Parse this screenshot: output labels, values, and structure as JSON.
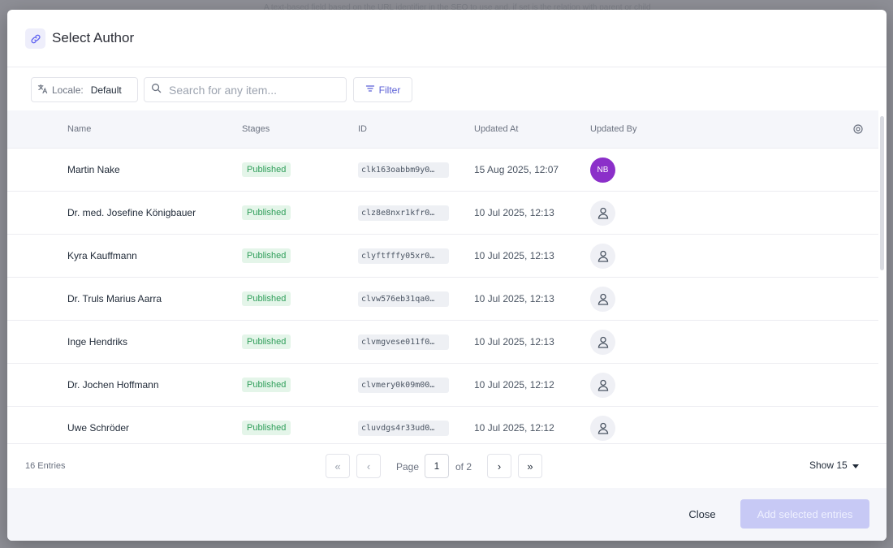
{
  "backdrop": {
    "text": "A text-based field based on the URL identifier in the SEO to use and, if set is the relation with parent or child"
  },
  "modal": {
    "title": "Select Author",
    "title_icon": "link-icon"
  },
  "toolbar": {
    "locale_label": "Locale:",
    "locale_value": "Default",
    "search_placeholder": "Search for any item...",
    "filter_label": "Filter"
  },
  "table": {
    "columns": {
      "name": "Name",
      "stages": "Stages",
      "id": "ID",
      "updated_at": "Updated At",
      "updated_by": "Updated By"
    },
    "rows": [
      {
        "name": "Martin Nake",
        "stage": "Published",
        "id": "clk163oabbm9y0…",
        "updated_at": "15 Aug 2025, 12:07",
        "updated_by": "NB",
        "avatar_type": "initials"
      },
      {
        "name": "Dr. med. Josefine Königbauer",
        "stage": "Published",
        "id": "clz8e8nxr1kfr0…",
        "updated_at": "10 Jul 2025, 12:13",
        "updated_by": "",
        "avatar_type": "generic"
      },
      {
        "name": "Kyra Kauffmann",
        "stage": "Published",
        "id": "clyftfffy05xr0…",
        "updated_at": "10 Jul 2025, 12:13",
        "updated_by": "",
        "avatar_type": "generic"
      },
      {
        "name": "Dr. Truls Marius Aarra",
        "stage": "Published",
        "id": "clvw576eb31qa0…",
        "updated_at": "10 Jul 2025, 12:13",
        "updated_by": "",
        "avatar_type": "generic"
      },
      {
        "name": "Inge Hendriks",
        "stage": "Published",
        "id": "clvmgvese011f0…",
        "updated_at": "10 Jul 2025, 12:13",
        "updated_by": "",
        "avatar_type": "generic"
      },
      {
        "name": "Dr. Jochen Hoffmann",
        "stage": "Published",
        "id": "clvmery0k09m00…",
        "updated_at": "10 Jul 2025, 12:12",
        "updated_by": "",
        "avatar_type": "generic"
      },
      {
        "name": "Uwe Schröder",
        "stage": "Published",
        "id": "cluvdgs4r33ud0…",
        "updated_at": "10 Jul 2025, 12:12",
        "updated_by": "",
        "avatar_type": "generic"
      }
    ]
  },
  "pagination": {
    "entries": "16 Entries",
    "page_label": "Page",
    "current_page": "1",
    "of_label": "of 2",
    "show_label": "Show 15"
  },
  "actions": {
    "close_label": "Close",
    "add_label": "Add selected entries"
  },
  "colors": {
    "accent": "#5b5fd6",
    "published_bg": "#e4f5e9",
    "published_text": "#2f9e5a",
    "avatar_initials_bg": "#8b2fc9"
  }
}
